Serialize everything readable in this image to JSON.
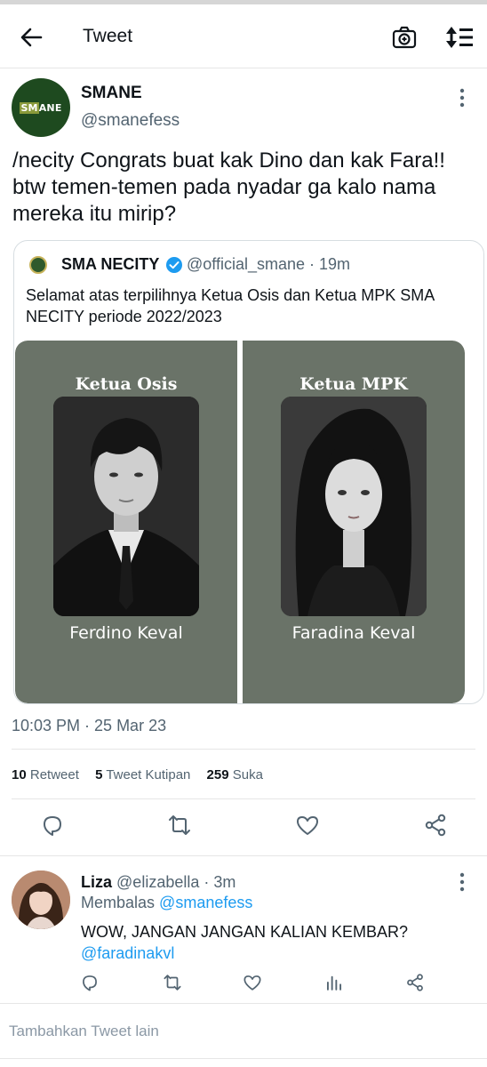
{
  "header": {
    "title": "Tweet",
    "back_icon": "arrow-left-icon",
    "camera_icon": "camera-plus-icon",
    "sort_icon": "sort-icon"
  },
  "tweet": {
    "author_name": "SMANE",
    "author_handle": "@smanefess",
    "avatar_text_a": "SM",
    "avatar_text_b": "ANE",
    "text": "/necity Congrats buat kak Dino dan kak Fara!! btw temen-temen pada nyadar ga kalo nama mereka itu mirip?",
    "timestamp": "10:03 PM · 25 Mar 23",
    "stats": {
      "retweets": "10",
      "retweets_label": "Retweet",
      "quotes": "5",
      "quotes_label": "Tweet Kutipan",
      "likes": "259",
      "likes_label": "Suka"
    }
  },
  "quote": {
    "name": "SMA NECITY",
    "handle_time": "@official_smane · 19m",
    "text": "Selamat atas terpilihnya Ketua Osis dan Ketua MPK SMA NECITY periode 2022/2023",
    "panels": [
      {
        "title": "Ketua Osis",
        "name": "Ferdino Keval"
      },
      {
        "title": "Ketua MPK",
        "name": "Faradina Keval"
      }
    ]
  },
  "reply": {
    "name": "Liza",
    "handle_time": "@elizabella · 3m",
    "replying_prefix": "Membalas",
    "replying_to": "@smanefess",
    "text": "WOW, JANGAN JANGAN KALIAN KEMBAR?",
    "mention": "@faradinakvl"
  },
  "compose": {
    "placeholder": "Tambahkan Tweet lain"
  },
  "colors": {
    "accent": "#1d9bf0",
    "muted": "#536471",
    "panel": "#6a7368",
    "avatar_green": "#1e4a1f"
  }
}
